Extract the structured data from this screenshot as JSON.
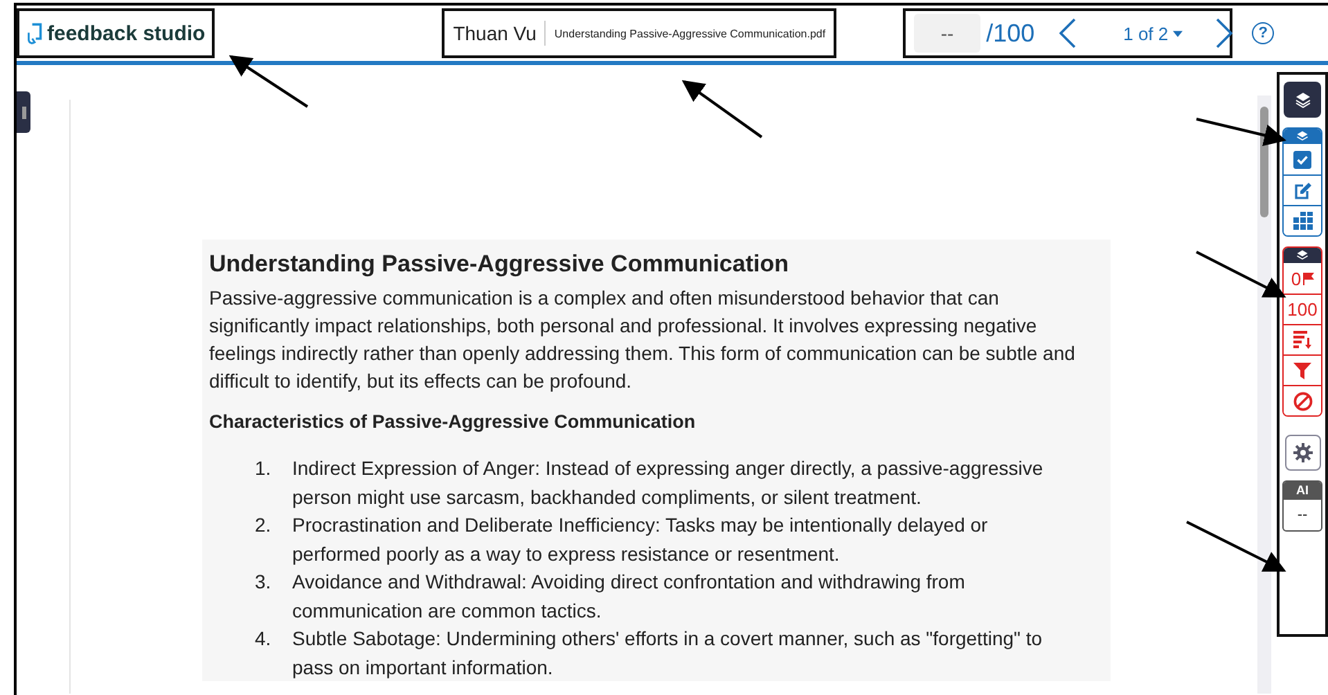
{
  "header": {
    "logo": "feedback studio",
    "author": "Thuan Vu",
    "file_name": "Understanding Passive-Aggressive Communication.pdf",
    "grade": {
      "placeholder": "--",
      "total": "/100"
    },
    "page_picker": "1 of 2",
    "help": "?"
  },
  "document": {
    "title": "Understanding Passive-Aggressive Communication",
    "intro": "Passive-aggressive communication is a complex and often misunderstood behavior that can significantly impact relationships, both personal and professional. It involves expressing negative feelings indirectly rather than openly addressing them. This form of communication can be subtle and difficult to identify, but its effects can be profound.",
    "subheading": "Characteristics of Passive-Aggressive Communication",
    "list": [
      {
        "number": "1.",
        "text": "Indirect Expression of Anger: Instead of expressing anger directly, a passive-aggressive person might use sarcasm, backhanded compliments, or silent treatment."
      },
      {
        "number": "2.",
        "text": "Procrastination and Deliberate Inefficiency: Tasks may be intentionally delayed or performed poorly as a way to express resistance or resentment."
      },
      {
        "number": "3.",
        "text": "Avoidance and Withdrawal: Avoiding direct confrontation and withdrawing from communication are common tactics."
      },
      {
        "number": "4.",
        "text": "Subtle Sabotage: Undermining others' efforts in a covert manner, such as \"forgetting\" to pass on important information."
      }
    ]
  },
  "toolbar": {
    "groups": [
      {
        "color": "#1d6fb8",
        "items": [
          {
            "kind": "check"
          },
          {
            "kind": "edit"
          },
          {
            "kind": "grid"
          }
        ]
      },
      {
        "color": "#e02424",
        "items": [
          {
            "kind": "flag",
            "text": "0"
          },
          {
            "kind": "number",
            "text": "100"
          },
          {
            "kind": "sort"
          },
          {
            "kind": "filter"
          },
          {
            "kind": "block"
          }
        ]
      }
    ],
    "ai": {
      "label": "AI",
      "value": "--"
    }
  }
}
